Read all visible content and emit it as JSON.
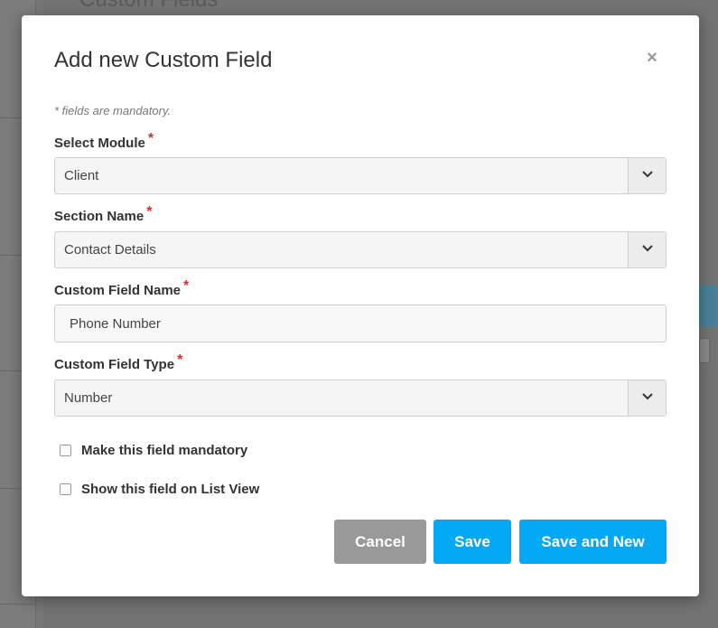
{
  "background": {
    "page_title": "Custom Fields"
  },
  "modal": {
    "title": "Add new Custom Field",
    "close_symbol": "×",
    "mandatory_note": "* fields are mandatory.",
    "required_marker": "*",
    "fields": {
      "module": {
        "label": "Select Module",
        "value": "Client"
      },
      "section": {
        "label": "Section Name",
        "value": "Contact Details"
      },
      "field_name": {
        "label": "Custom Field Name",
        "value": "Phone Number"
      },
      "field_type": {
        "label": "Custom Field Type",
        "value": "Number"
      }
    },
    "checkboxes": {
      "mandatory": {
        "label": "Make this field mandatory",
        "checked": false
      },
      "list_view": {
        "label": "Show this field on List View",
        "checked": false
      }
    },
    "buttons": {
      "cancel": "Cancel",
      "save": "Save",
      "save_new": "Save and New"
    }
  },
  "colors": {
    "primary": "#03a9f4",
    "cancel": "#999999",
    "required": "#d32f2f"
  }
}
